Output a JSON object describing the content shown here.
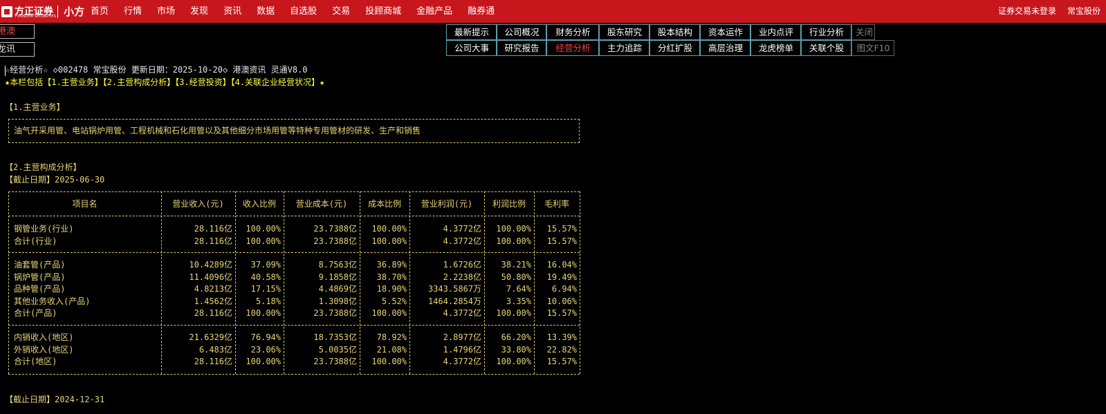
{
  "topbar": {
    "logo_text": "方正证券",
    "logo_subtext": "FOUNDER SECURITIES",
    "brand": "小方",
    "nav": [
      "首页",
      "行情",
      "市场",
      "发现",
      "资讯",
      "数据",
      "自选股",
      "交易",
      "投顾商城",
      "金融产品",
      "融券通"
    ],
    "login_status": "证券交易未登录",
    "stock_name": "常宝股份"
  },
  "side_tabs": [
    "港澳",
    "龙讯"
  ],
  "f10_tabs": {
    "row1": [
      "最新提示",
      "公司概况",
      "财务分析",
      "股东研究",
      "股本结构",
      "资本运作",
      "业内点评",
      "行业分析",
      "关闭"
    ],
    "row2": [
      "公司大事",
      "研究报告",
      "经营分析",
      "主力追踪",
      "分红扩股",
      "高层治理",
      "龙虎榜单",
      "关联个股",
      "图文F10"
    ],
    "active": "经营分析"
  },
  "content": {
    "header": "☆经营分析☆ ◇002478 常宝股份 更新日期：2025-10-20◇ 港澳资讯 灵通V8.0",
    "contents_line": "★本栏包括【1.主营业务】【2.主营构成分析】【3.经营投资】【4.关联企业经营状况】★",
    "section1_title": "【1.主营业务】",
    "main_business": "油气开采用管、电站锅炉用管、工程机械和石化用管以及其他细分市场用管等特种专用管材的研发、生产和销售",
    "section2_title": "【2.主营构成分析】",
    "cutoff_date_1": "【截止日期】2025-06-30",
    "cutoff_date_2": "【截止日期】2024-12-31"
  },
  "table": {
    "headers": [
      "项目名",
      "营业收入(元)",
      "收入比例",
      "营业成本(元)",
      "成本比例",
      "营业利润(元)",
      "利润比例",
      "毛利率"
    ],
    "groups": [
      [
        [
          "钢管业务(行业)",
          "28.116亿",
          "100.00%",
          "23.7388亿",
          "100.00%",
          "4.3772亿",
          "100.00%",
          "15.57%"
        ],
        [
          "合计(行业)",
          "28.116亿",
          "100.00%",
          "23.7388亿",
          "100.00%",
          "4.3772亿",
          "100.00%",
          "15.57%"
        ]
      ],
      [
        [
          "油套管(产品)",
          "10.4289亿",
          "37.09%",
          "8.7563亿",
          "36.89%",
          "1.6726亿",
          "38.21%",
          "16.04%"
        ],
        [
          "锅炉管(产品)",
          "11.4096亿",
          "40.58%",
          "9.1858亿",
          "38.70%",
          "2.2238亿",
          "50.80%",
          "19.49%"
        ],
        [
          "品种管(产品)",
          "4.8213亿",
          "17.15%",
          "4.4869亿",
          "18.90%",
          "3343.5867万",
          "7.64%",
          "6.94%"
        ],
        [
          "其他业务收入(产品)",
          "1.4562亿",
          "5.18%",
          "1.3098亿",
          "5.52%",
          "1464.2854万",
          "3.35%",
          "10.06%"
        ],
        [
          "合计(产品)",
          "28.116亿",
          "100.00%",
          "23.7388亿",
          "100.00%",
          "4.3772亿",
          "100.00%",
          "15.57%"
        ]
      ],
      [
        [
          "内销收入(地区)",
          "21.6329亿",
          "76.94%",
          "18.7353亿",
          "78.92%",
          "2.8977亿",
          "66.20%",
          "13.39%"
        ],
        [
          "外销收入(地区)",
          "6.483亿",
          "23.06%",
          "5.0035亿",
          "21.08%",
          "1.4796亿",
          "33.80%",
          "22.82%"
        ],
        [
          "合计(地区)",
          "28.116亿",
          "100.00%",
          "23.7388亿",
          "100.00%",
          "4.3772亿",
          "100.00%",
          "15.57%"
        ]
      ]
    ]
  }
}
